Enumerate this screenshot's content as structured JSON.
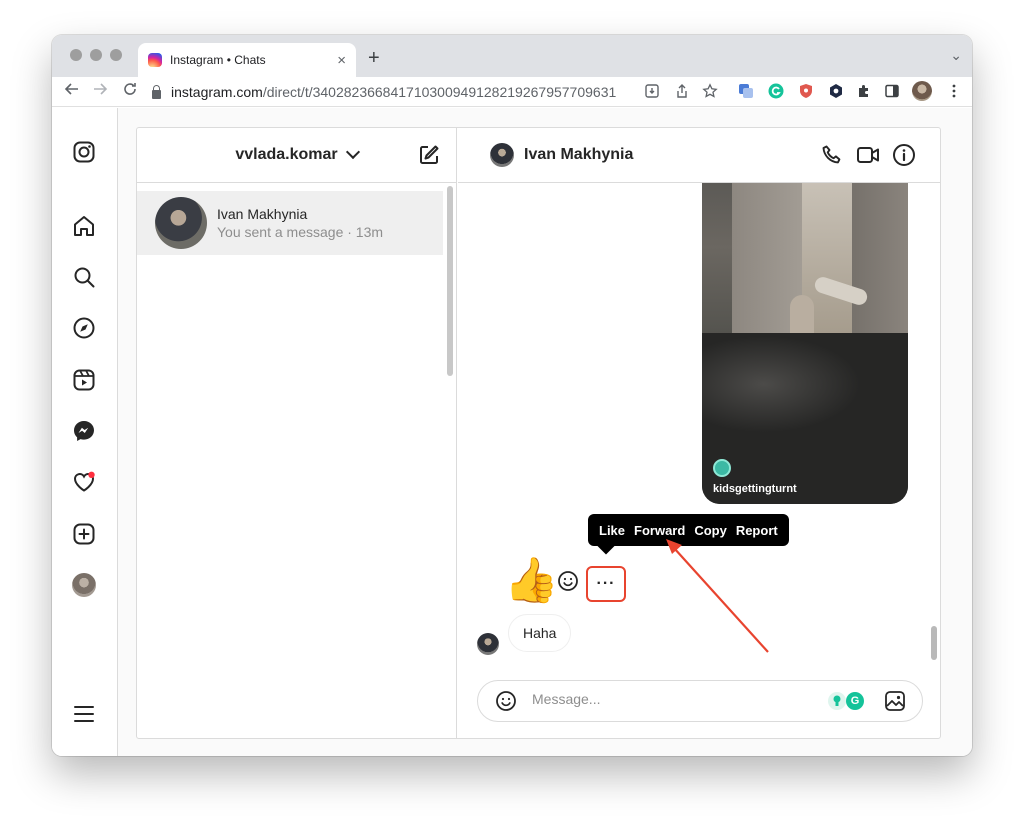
{
  "browser": {
    "tab_title": "Instagram • Chats",
    "tab_close": "×",
    "new_tab": "+",
    "tab_menu": "⌄",
    "url_host": "instagram.com",
    "url_path": "/direct/t/340282366841710300949128219267957709631"
  },
  "inbox": {
    "account_name": "vvlada.komar",
    "threads": [
      {
        "name": "Ivan Makhynia",
        "preview": "You sent a message · 13m"
      }
    ]
  },
  "chat": {
    "contact_name": "Ivan Makhynia",
    "shared_media_user": "kidsgettingturnt",
    "reaction_emoji": "👍",
    "more_button": "···",
    "menu": {
      "like": "Like",
      "forward": "Forward",
      "copy": "Copy",
      "report": "Report"
    },
    "incoming_message": "Haha",
    "composer_placeholder": "Message...",
    "grammarly_badge": "G"
  },
  "colors": {
    "accent_annotation": "#e8442f",
    "notification_dot": "#ff3040",
    "grammarly": "#15c39a"
  }
}
